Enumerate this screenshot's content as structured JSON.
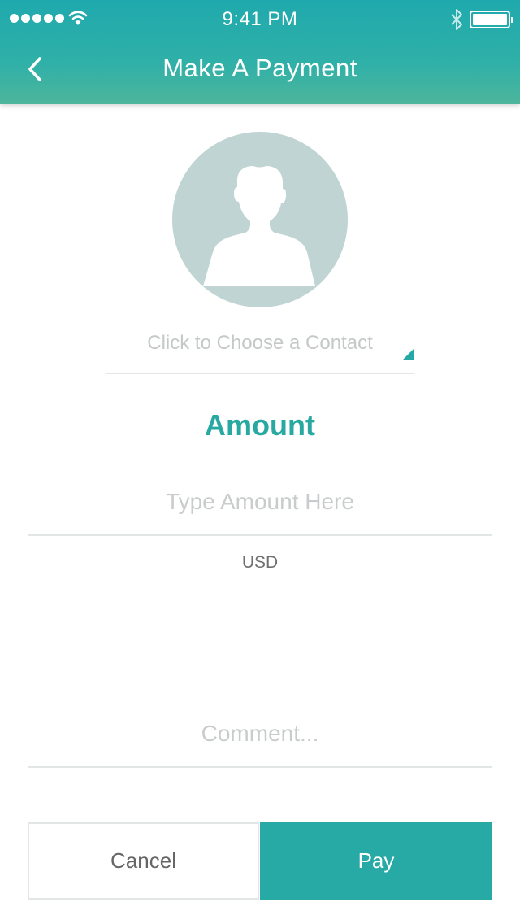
{
  "status_bar": {
    "time": "9:41 PM",
    "signal_icon": "signal-dots-icon",
    "wifi_icon": "wifi-icon",
    "bluetooth_icon": "bluetooth-icon",
    "battery_icon": "battery-icon",
    "battery_level": 1.0
  },
  "header": {
    "title": "Make A Payment",
    "back_icon": "chevron-left-icon"
  },
  "colors": {
    "accent": "#27aaa6",
    "header_gradient": [
      "#1fa9ad",
      "#4db59c"
    ],
    "avatar_bg": "#bfd4d3",
    "placeholder": "#c9cccc"
  },
  "contact": {
    "avatar_icon": "user-silhouette-icon",
    "label": "Click to Choose a Contact",
    "caret_icon": "dropdown-corner-icon"
  },
  "amount": {
    "heading": "Amount",
    "placeholder": "Type Amount Here",
    "value": "",
    "currency": "USD"
  },
  "comment": {
    "placeholder": "Comment...",
    "value": ""
  },
  "actions": {
    "cancel_label": "Cancel",
    "pay_label": "Pay"
  }
}
